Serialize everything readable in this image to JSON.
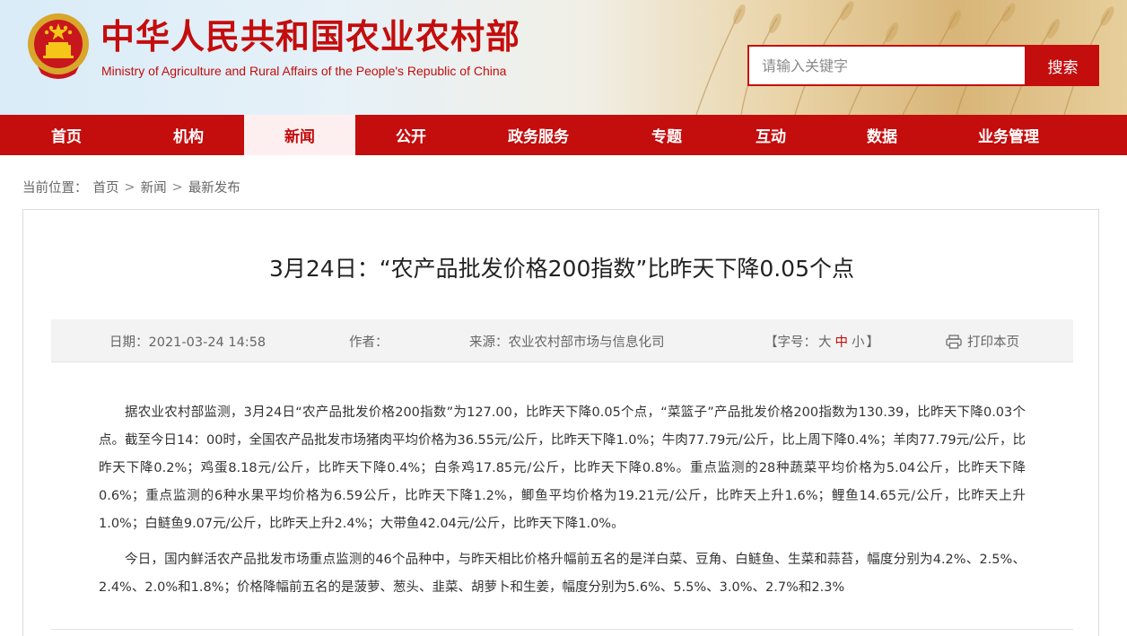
{
  "header": {
    "title_cn": "中华人民共和国农业农村部",
    "title_en": "Ministry of Agriculture and Rural Affairs of the People's Republic of China",
    "search_placeholder": "请输入关键字",
    "search_button": "搜索",
    "emblem_icon": "national-emblem-icon"
  },
  "nav": {
    "items": [
      {
        "label": "首页",
        "active": false
      },
      {
        "label": "机构",
        "active": false
      },
      {
        "label": "新闻",
        "active": true
      },
      {
        "label": "公开",
        "active": false
      },
      {
        "label": "政务服务",
        "active": false
      },
      {
        "label": "专题",
        "active": false
      },
      {
        "label": "互动",
        "active": false
      },
      {
        "label": "数据",
        "active": false
      },
      {
        "label": "业务管理",
        "active": false
      }
    ]
  },
  "breadcrumb": {
    "prefix": "当前位置：",
    "items": [
      "首页",
      "新闻",
      "最新发布"
    ],
    "separator": ">"
  },
  "article": {
    "title": "3月24日：“农产品批发价格200指数”比昨天下降0.05个点",
    "meta": {
      "date": "日期：2021-03-24 14:58",
      "author": "作者：",
      "source": "来源：农业农村部市场与信息化司",
      "fontsize_open": "【字号：",
      "fontsize_large": "大",
      "fontsize_medium": "中",
      "fontsize_small": "小",
      "fontsize_close": "】",
      "print": "打印本页",
      "print_icon": "printer-icon"
    },
    "paragraphs": [
      "据农业农村部监测，3月24日“农产品批发价格200指数”为127.00，比昨天下降0.05个点，“菜篮子”产品批发价格200指数为130.39，比昨天下降0.03个点。截至今日14：00时，全国农产品批发市场猪肉平均价格为36.55元/公斤，比昨天下降1.0%；牛肉77.79元/公斤，比上周下降0.4%；羊肉77.79元/公斤，比昨天下降0.2%；鸡蛋8.18元/公斤，比昨天下降0.4%；白条鸡17.85元/公斤，比昨天下降0.8%。重点监测的28种蔬菜平均价格为5.04公斤，比昨天下降0.6%；重点监测的6种水果平均价格为6.59公斤，比昨天下降1.2%，鲫鱼平均价格为19.21元/公斤，比昨天上升1.6%；鲤鱼14.65元/公斤，比昨天上升1.0%；白鲢鱼9.07元/公斤，比昨天上升2.4%；大带鱼42.04元/公斤，比昨天下降1.0%。",
      "今日，国内鲜活农产品批发市场重点监测的46个品种中，与昨天相比价格升幅前五名的是洋白菜、豆角、白鲢鱼、生菜和蒜苔，幅度分别为4.2%、2.5%、2.4%、2.0%和1.8%；价格降幅前五名的是菠萝、葱头、韭菜、胡萝卜和生姜，幅度分别为5.6%、5.5%、3.0%、2.7%和2.3%"
    ]
  },
  "colors": {
    "brand_red": "#c40d0d",
    "nav_active_bg": "#fdeff0",
    "meta_bg": "#f3f3f3"
  }
}
